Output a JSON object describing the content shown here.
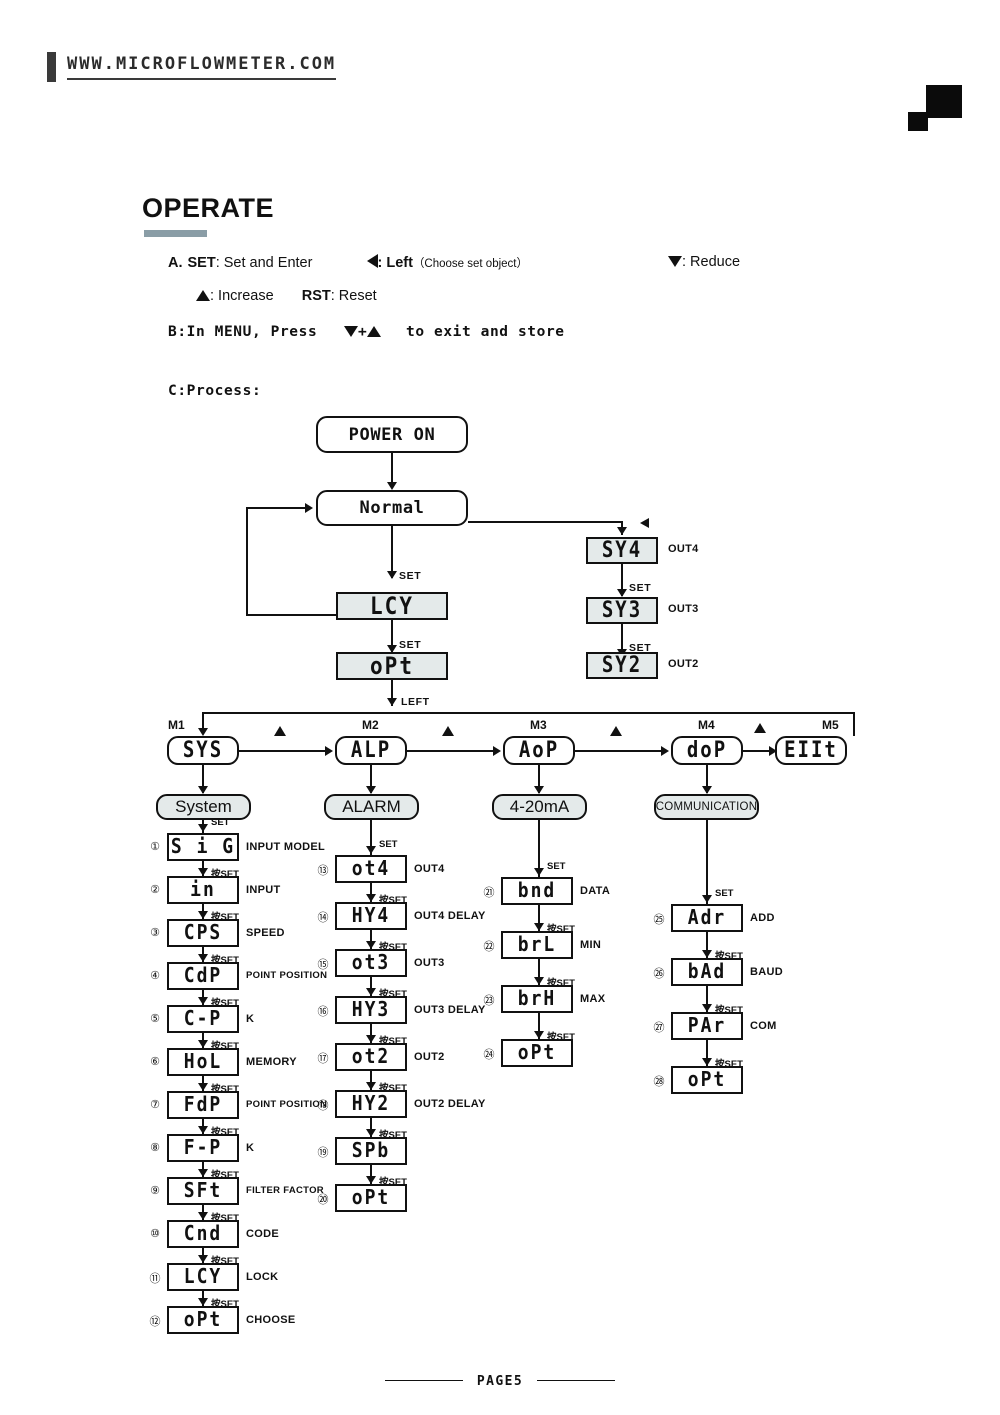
{
  "header": {
    "site_url": "WWW.MICROFLOWMETER.COM"
  },
  "title": "OPERATE",
  "legend": {
    "a_prefix": "A.",
    "set_key": "SET",
    "set_desc": ": Set and Enter",
    "left_desc": ": Left",
    "left_note": "（Choose set object）",
    "reduce_desc": ": Reduce",
    "increase_desc": ": Increase",
    "rst_key": "RST",
    "rst_desc": ": Reset",
    "b_line_1": "B:In MENU, Press",
    "b_plus": "+",
    "b_line_2": "to exit and store",
    "c_line": "C:Process:"
  },
  "flow": {
    "power_on": "POWER ON",
    "normal": "Normal",
    "lcy": "LCY",
    "opt": "oPt",
    "set_label": "SET",
    "left_label": "LEFT",
    "press_set_label": "按SET",
    "out_branch": [
      {
        "code": "SY4",
        "label": "OUT4"
      },
      {
        "code": "SY3",
        "label": "OUT3"
      },
      {
        "code": "SY2",
        "label": "OUT2"
      }
    ]
  },
  "menus": [
    {
      "id": "M1",
      "code": "SYS",
      "name": "System",
      "items": [
        {
          "num": "①",
          "code": "S i G",
          "label": "INPUT MODEL"
        },
        {
          "num": "②",
          "code": "in",
          "label": "INPUT"
        },
        {
          "num": "③",
          "code": "CPS",
          "label": "SPEED"
        },
        {
          "num": "④",
          "code": "CdP",
          "label": "POINT POSITION"
        },
        {
          "num": "⑤",
          "code": "C-P",
          "label": "K"
        },
        {
          "num": "⑥",
          "code": "HoL",
          "label": "MEMORY"
        },
        {
          "num": "⑦",
          "code": "FdP",
          "label": "POINT POSITION"
        },
        {
          "num": "⑧",
          "code": "F-P",
          "label": "K"
        },
        {
          "num": "⑨",
          "code": "SFt",
          "label": "FILTER FACTOR"
        },
        {
          "num": "⑩",
          "code": "Cnd",
          "label": "CODE"
        },
        {
          "num": "⑪",
          "code": "LCY",
          "label": "LOCK"
        },
        {
          "num": "⑫",
          "code": "oPt",
          "label": "CHOOSE"
        }
      ]
    },
    {
      "id": "M2",
      "code": "ALP",
      "name": "ALARM",
      "items": [
        {
          "num": "⑬",
          "code": "ot4",
          "label": "OUT4"
        },
        {
          "num": "⑭",
          "code": "HY4",
          "label": "OUT4 DELAY"
        },
        {
          "num": "⑮",
          "code": "ot3",
          "label": "OUT3"
        },
        {
          "num": "⑯",
          "code": "HY3",
          "label": "OUT3 DELAY"
        },
        {
          "num": "⑰",
          "code": "ot2",
          "label": "OUT2"
        },
        {
          "num": "⑱",
          "code": "HY2",
          "label": "OUT2 DELAY"
        },
        {
          "num": "⑲",
          "code": "SPb",
          "label": ""
        },
        {
          "num": "⑳",
          "code": "oPt",
          "label": ""
        }
      ]
    },
    {
      "id": "M3",
      "code": "AoP",
      "name": "4-20mA",
      "items": [
        {
          "num": "㉑",
          "code": "bnd",
          "label": "DATA"
        },
        {
          "num": "㉒",
          "code": "brL",
          "label": "MIN"
        },
        {
          "num": "㉓",
          "code": "brH",
          "label": "MAX"
        },
        {
          "num": "㉔",
          "code": "oPt",
          "label": ""
        }
      ]
    },
    {
      "id": "M4",
      "code": "doP",
      "name": "COMMUNICATION",
      "items": [
        {
          "num": "㉕",
          "code": "Adr",
          "label": "ADD"
        },
        {
          "num": "㉖",
          "code": "bAd",
          "label": "BAUD"
        },
        {
          "num": "㉗",
          "code": "PAr",
          "label": "COM"
        },
        {
          "num": "㉘",
          "code": "oPt",
          "label": ""
        }
      ]
    },
    {
      "id": "M5",
      "code": "EIIt",
      "name": ""
    }
  ],
  "footer": {
    "page": "PAGE5"
  },
  "colors": {
    "accent": "#8a9da6",
    "lcd_fill": "#e4eaea",
    "ink": "#111111"
  }
}
